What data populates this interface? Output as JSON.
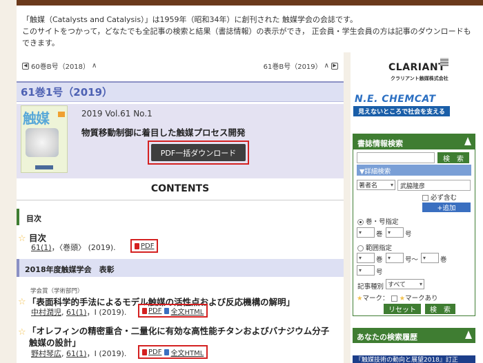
{
  "intro": {
    "line1": "「触媒（Catalysts and Catalysis）」は1959年（昭和34年）に創刊された 触媒学会の会誌です。",
    "line2": "このサイトをつかって，どなたでも全記事の検索と結果（書誌情報）の表示ができ， 正会員・学生会員の方は記事のダウンロードもできます。"
  },
  "nav": {
    "prev_label": "60巻B号（2018）",
    "next_label": "61巻B号（2019）"
  },
  "volume": {
    "title": "61巻1号（2019）",
    "date": "2019 Vol.61 No.1",
    "feature": "物質移動制御に着目した触媒プロセス開発",
    "pdf_all_label": "PDF一括ダウンロード",
    "cover_title": "触媒"
  },
  "contents_heading": "CONTENTS",
  "sections": [
    {
      "label": "目次"
    },
    {
      "label": "2018年度触媒学会　表彰"
    }
  ],
  "articles": [
    {
      "title": "目次",
      "ref_vol": "61(1)",
      "ref_rest": "，〈巻頭〉 (2019).",
      "pdf": "PDF"
    },
    {
      "category": "学会賞（学術部門）",
      "title": "「表面科学的手法によるモデル触媒の活性点および反応機構の解明」",
      "author": "中村潤児",
      "ref_vol": "61(1)",
      "ref_rest": "，Ⅰ (2019).",
      "pdf": "PDF",
      "html": "全文HTML"
    },
    {
      "title_line1": "「オレフィンの精密重合・二量化に有効な高性能チタンおよびバナジウム分子",
      "title_line2": "触媒の設計」",
      "author": "野村琴広",
      "ref_vol": "61(1)",
      "ref_rest": "，Ⅰ (2019).",
      "pdf": "PDF",
      "html": "全文HTML"
    }
  ],
  "sidebar": {
    "sponsor1_name": "CLARIANT",
    "sponsor1_sub": "クラリアント触媒株式会社",
    "sponsor2_name": "N.E. CHEMCAT",
    "sponsor2_sub": "見えないところで社会を支える",
    "search": {
      "heading": "書誌情報検索",
      "search_button": "検　索",
      "advanced_label": "▼詳細検索",
      "field_select": "著者名",
      "field_value": "武脇隆彦",
      "must_include": "必ず含む",
      "add_button": "+追加",
      "vol_issue_label": "巻・号指定",
      "vol_unit": "巻",
      "issue_unit": "号",
      "range_label": "範囲指定",
      "range_issue_tilde": "号〜",
      "article_type_label": "記事種別",
      "article_type_value": "すべて",
      "mark_label": "マーク：",
      "mark_with": "マークあり",
      "reset_button": "リセット",
      "search_button2": "検　索"
    },
    "history_heading": "あなたの検索履歴",
    "banner_text": "『触媒技術の動向と展望2018』訂正"
  },
  "colors": {
    "brown": "#6b3a1c",
    "green": "#3f7d32",
    "lavender": "#dde0f3",
    "accent_blue": "#4d61b3",
    "red_highlight": "#d42020"
  }
}
